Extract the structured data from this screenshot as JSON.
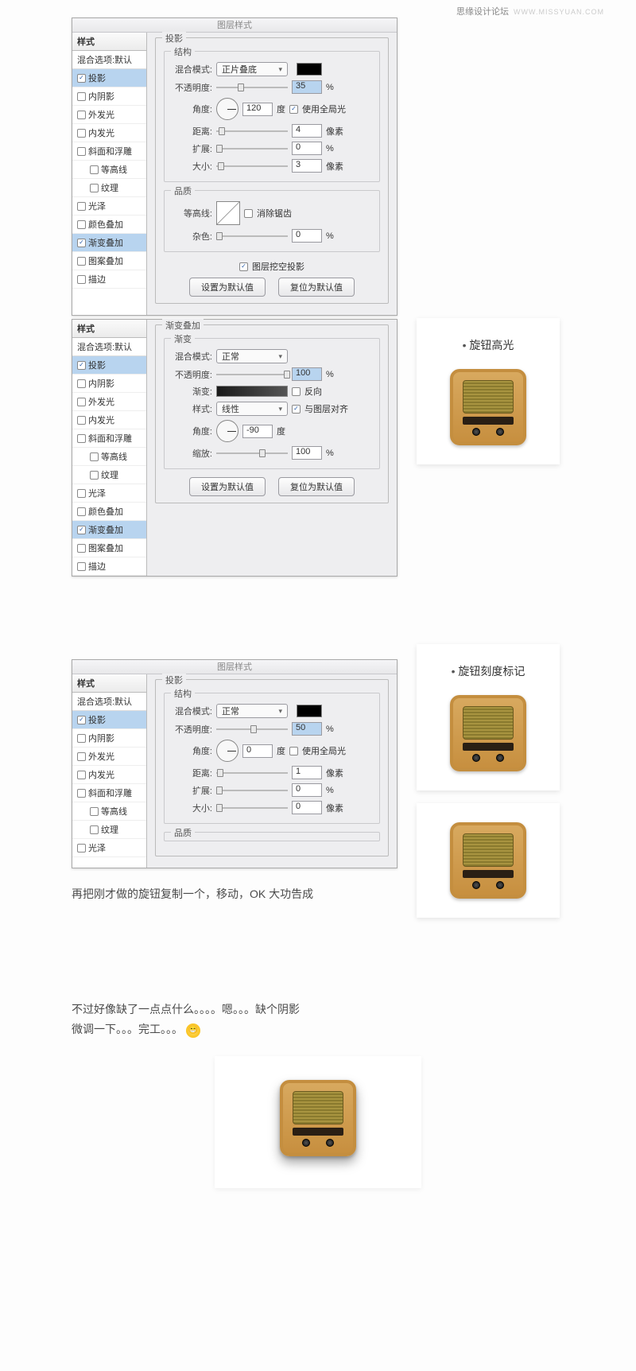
{
  "watermark": {
    "text": "思缘设计论坛",
    "url": "WWW.MISSYUAN.COM"
  },
  "dialog_title": "图层样式",
  "styles_header": "样式",
  "blend_opts": "混合选项:默认",
  "style_items": [
    {
      "label": "投影",
      "checked": true,
      "sel": true
    },
    {
      "label": "内阴影",
      "checked": false
    },
    {
      "label": "外发光",
      "checked": false
    },
    {
      "label": "内发光",
      "checked": false
    },
    {
      "label": "斜面和浮雕",
      "checked": false
    },
    {
      "label": "等高线",
      "checked": false,
      "indent": true
    },
    {
      "label": "纹理",
      "checked": false,
      "indent": true
    },
    {
      "label": "光泽",
      "checked": false
    },
    {
      "label": "颜色叠加",
      "checked": false
    },
    {
      "label": "渐变叠加",
      "checked": true,
      "sel": true
    },
    {
      "label": "图案叠加",
      "checked": false
    },
    {
      "label": "描边",
      "checked": false
    }
  ],
  "style_items_b": [
    {
      "label": "投影",
      "checked": true,
      "sel": true
    },
    {
      "label": "内阴影",
      "checked": false
    },
    {
      "label": "外发光",
      "checked": false
    },
    {
      "label": "内发光",
      "checked": false
    },
    {
      "label": "斜面和浮雕",
      "checked": false
    },
    {
      "label": "等高线",
      "checked": false,
      "indent": true
    },
    {
      "label": "纹理",
      "checked": false,
      "indent": true
    },
    {
      "label": "光泽",
      "checked": false
    },
    {
      "label": "颜色叠加",
      "checked": false
    },
    {
      "label": "渐变叠加",
      "checked": true,
      "sel": true
    },
    {
      "label": "图案叠加",
      "checked": false
    },
    {
      "label": "描边",
      "checked": false
    }
  ],
  "style_items_c": [
    {
      "label": "投影",
      "checked": true,
      "sel": true
    },
    {
      "label": "内阴影",
      "checked": false
    },
    {
      "label": "外发光",
      "checked": false
    },
    {
      "label": "内发光",
      "checked": false
    },
    {
      "label": "斜面和浮雕",
      "checked": false
    },
    {
      "label": "等高线",
      "checked": false,
      "indent": true
    },
    {
      "label": "纹理",
      "checked": false,
      "indent": true
    },
    {
      "label": "光泽",
      "checked": false
    }
  ],
  "panel1": {
    "title": "投影",
    "struct": "结构",
    "blend_label": "混合模式:",
    "blend_val": "正片叠底",
    "opacity_label": "不透明度:",
    "opacity_val": "35",
    "pct": "%",
    "angle_label": "角度:",
    "angle_val": "120",
    "deg": "度",
    "global": "使用全局光",
    "dist_label": "距离:",
    "dist_val": "4",
    "px": "像素",
    "spread_label": "扩展:",
    "spread_val": "0",
    "size_label": "大小:",
    "size_val": "3",
    "quality": "品质",
    "contour_label": "等高线:",
    "antialias": "消除锯齿",
    "noise_label": "杂色:",
    "noise_val": "0",
    "knockout": "图层挖空投影",
    "btn_set": "设置为默认值",
    "btn_reset": "复位为默认值"
  },
  "panel2": {
    "title": "渐变叠加",
    "grad": "渐变",
    "blend_label": "混合模式:",
    "blend_val": "正常",
    "opacity_label": "不透明度:",
    "opacity_val": "100",
    "pct": "%",
    "grad_label": "渐变:",
    "reverse": "反向",
    "style_label": "样式:",
    "style_val": "线性",
    "align": "与图层对齐",
    "angle_label": "角度:",
    "angle_val": "-90",
    "deg": "度",
    "scale_label": "缩放:",
    "scale_val": "100",
    "btn_set": "设置为默认值",
    "btn_reset": "复位为默认值"
  },
  "panel3": {
    "title": "投影",
    "struct": "结构",
    "blend_label": "混合模式:",
    "blend_val": "正常",
    "opacity_label": "不透明度:",
    "opacity_val": "50",
    "pct": "%",
    "angle_label": "角度:",
    "angle_val": "0",
    "deg": "度",
    "global": "使用全局光",
    "dist_label": "距离:",
    "dist_val": "1",
    "px": "像素",
    "spread_label": "扩展:",
    "spread_val": "0",
    "size_label": "大小:",
    "size_val": "0",
    "quality": "品质"
  },
  "preview1": {
    "cap": "旋钮高光"
  },
  "preview2": {
    "cap": "旋钮刻度标记"
  },
  "text1": "再把刚才做的旋钮复制一个，移动，OK  大功告成",
  "text2a": "不过好像缺了一点点什么。。。。嗯。。。缺个阴影",
  "text2b": "微调一下。。。完工。。。"
}
